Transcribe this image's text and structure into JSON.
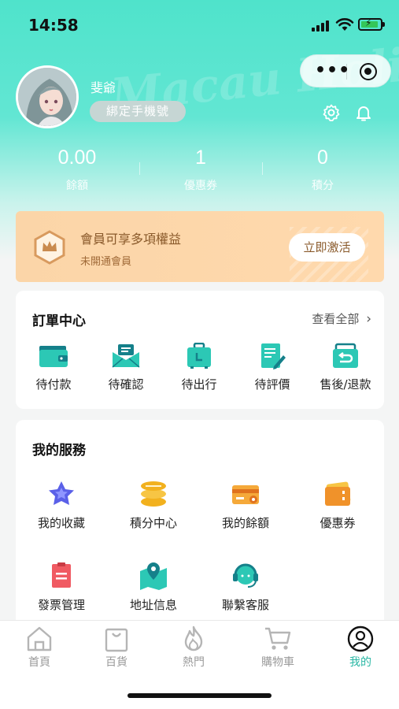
{
  "status_bar": {
    "time": "14:58"
  },
  "header": {
    "watermark": "Macau Holiday"
  },
  "profile": {
    "username": "斐爺",
    "bind_phone_label": "綁定手機號"
  },
  "stats": [
    {
      "value": "0.00",
      "label": "餘額"
    },
    {
      "value": "1",
      "label": "優惠券"
    },
    {
      "value": "0",
      "label": "積分"
    }
  ],
  "member": {
    "title": "會員可享多項權益",
    "subtitle": "未開通會員",
    "activate_label": "立即激活"
  },
  "orders": {
    "title": "訂單中心",
    "view_all": "查看全部",
    "items": [
      {
        "label": "待付款",
        "icon": "wallet-icon"
      },
      {
        "label": "待確認",
        "icon": "envelope-icon"
      },
      {
        "label": "待出行",
        "icon": "luggage-icon"
      },
      {
        "label": "待評價",
        "icon": "review-icon"
      },
      {
        "label": "售後/退款",
        "icon": "refund-icon"
      }
    ]
  },
  "services": {
    "title": "我的服務",
    "items": [
      {
        "label": "我的收藏",
        "icon": "star-icon"
      },
      {
        "label": "積分中心",
        "icon": "coins-icon"
      },
      {
        "label": "我的餘額",
        "icon": "card-icon"
      },
      {
        "label": "優惠券",
        "icon": "coupon-icon"
      },
      {
        "label": "發票管理",
        "icon": "invoice-icon"
      },
      {
        "label": "地址信息",
        "icon": "map-pin-icon"
      },
      {
        "label": "聯繫客服",
        "icon": "headset-icon"
      }
    ]
  },
  "tabbar": {
    "items": [
      {
        "label": "首頁",
        "icon": "home-icon"
      },
      {
        "label": "百貨",
        "icon": "bag-icon"
      },
      {
        "label": "熱門",
        "icon": "flame-icon"
      },
      {
        "label": "購物車",
        "icon": "cart-icon"
      },
      {
        "label": "我的",
        "icon": "user-icon",
        "active": true
      }
    ]
  },
  "colors": {
    "accent": "#29b7a4",
    "header": "#4fe3cb",
    "member_bg": "#fbd5a8"
  }
}
